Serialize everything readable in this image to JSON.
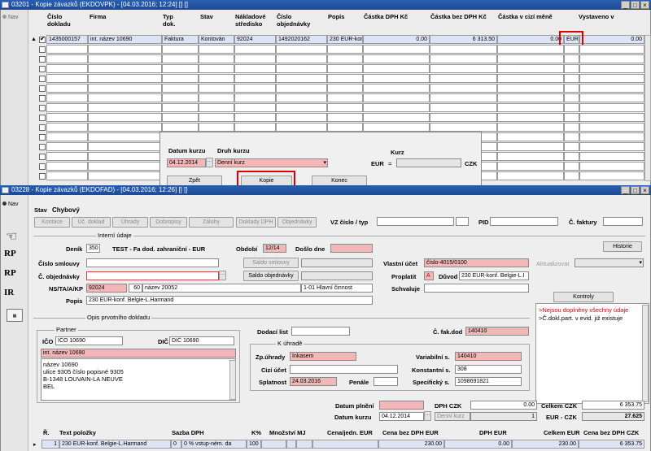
{
  "win1": {
    "title": "03201 - Kopie závazků (EKDOVPK) - [04.03.2016; 12:24] [] []",
    "controls": [
      "_",
      "□",
      "×"
    ],
    "nav_label": "Nav",
    "columns": [
      "Číslo dokladu",
      "Firma",
      "Typ dok.",
      "Stav",
      "Nákladové středisko",
      "Číslo objednávky",
      "Popis",
      "Částka DPH Kč",
      "Částka bez DPH Kč",
      "Částka v cizí měně",
      "Vystaveno v"
    ],
    "row": {
      "cislo": "1435000157",
      "firma": "int. název 10690",
      "typ": "Faktura",
      "stav": "Kontován",
      "stredisko": "92024",
      "objednavka": "1492020162",
      "popis": "230 EUR-konf",
      "dph": "0.00",
      "bez_dph": "6 313.50",
      "cizi": "0.00",
      "mena": "EUR",
      "vystaveno": "0.00"
    }
  },
  "dialog": {
    "datum_kurzu_label": "Datum kurzu",
    "datum_kurzu": "04.12.2014",
    "druh_kurzu_label": "Druh kurzu",
    "druh_kurzu": "Denní kurz",
    "kurz_label": "Kurz",
    "eur": "EUR",
    "czk": "CZK",
    "eq": "=",
    "zpet": "Zpět",
    "kopie": "Kopie",
    "konec": "Konec"
  },
  "win2": {
    "title": "03228 - Kopie závazků (EKDOFAD) - [04.03.2016; 12:26] [] []",
    "nav_label": "Nav",
    "stav_label": "Stav",
    "stav": "Chybový",
    "tabs": [
      "Kontace",
      "Úč. doklad",
      "Úhrady",
      "Dobropisy",
      "Zálohy",
      "Doklady DPH",
      "Objednávky"
    ],
    "vz_label": "VZ číslo / typ",
    "pid_label": "PID",
    "faktura_label": "Č. faktury",
    "interni_udaje": "Interní údaje",
    "denik_label": "Deník",
    "denik": "350",
    "denik_name": "TEST - Fa dod. zahraniční - EUR",
    "obdobi_label": "Období",
    "obdobi": "12/14",
    "doslo_label": "Došlo dne",
    "historie": "Historie",
    "cislo_smlouvy_label": "Číslo smlouvy",
    "saldo_smlouvy": "Saldo smlouvy",
    "vlastni_ucet_label": "Vlastní účet",
    "vlastni_ucet": "číslo-4015/0100",
    "aktualizovat": "Aktualizovat",
    "objednavky_label": "Č. objednávky",
    "saldo_objednavky": "Saldo objednávky",
    "proplatit_label": "Proplatit",
    "proplatit": "A",
    "duvod_label": "Důvod",
    "duvod": "230 EUR-konf. Belgie-L.I",
    "ns_label": "NS/TA/A/KP",
    "ns": "92024",
    "ta": "60",
    "ta_name": "název 20052",
    "kp": "1-01 Hlavní činnost",
    "schvaluje_label": "Schvaluje",
    "popis_label": "Popis",
    "popis": "230 EUR-konf. Belgie-L.Harmand",
    "kontroly_label": "Kontroly",
    "kontroly": [
      ">Nejsou doplněny všechny údaje",
      ">Č.dokl.part. v evid. již existuje"
    ],
    "opis_label": "Opis prvotního dokladu",
    "partner_label": "Partner",
    "ico_label": "IČO",
    "ico": "IČO 10690",
    "dic_label": "DIČ",
    "dic": "DIČ 10690",
    "partner_name": "int. název 10690",
    "address": [
      "název 10690",
      "ulice 9305 číslo popisné 9305",
      "B-1348 LOUVAIN-LA NEUVE",
      "BEL"
    ],
    "dodaci_list_label": "Dodací list",
    "c_fak_dod_label": "Č. fak.dod",
    "c_fak_dod": "140410",
    "k_uhrade_label": "K úhradě",
    "zp_uhrady_label": "Zp.úhrady",
    "zp_uhrady": "Inkasem",
    "variabilni_label": "Variabilní s.",
    "variabilni": "140410",
    "cizi_ucet_label": "Cizí účet",
    "konstantni_label": "Konstantní s.",
    "konstantni": "308",
    "splatnost_label": "Splatnost",
    "splatnost": "24.03.2016",
    "penale_label": "Penále",
    "specificky_label": "Specifický s.",
    "specificky": "1098691821",
    "datum_plneni_label": "Datum plnění",
    "datum_kurzu_label": "Datum kurzu",
    "datum_kurzu": "04.12.2014",
    "denni_kurz": "Denní kurz",
    "dph_czk_label": "DPH CZK",
    "dph_czk": "0.00",
    "celkem_czk_label": "Celkem CZK",
    "celkem_czk": "6 353.75",
    "one": "1",
    "eur_czk_label": "EUR - CZK",
    "eur_czk": "27.625",
    "items_headers": [
      "Ř.",
      "Text položky",
      "Sazba DPH",
      "K%",
      "Množství MJ",
      "Cena/jedn. EUR",
      "Cena bez DPH EUR",
      "DPH EUR",
      "Celkem EUR",
      "Cena bez DPH CZK"
    ],
    "item": {
      "r": "1",
      "text": "230 EUR-konf. Belgie-L.Harmand",
      "sazba_code": "0",
      "sazba": "0 % vstup-ném. da",
      "k": "100",
      "cena_bez": "230.00",
      "dph": "0.00",
      "celkem": "230.00",
      "czk": "6 353.75"
    },
    "side_icons": [
      "RP",
      "RP",
      "IR"
    ]
  }
}
